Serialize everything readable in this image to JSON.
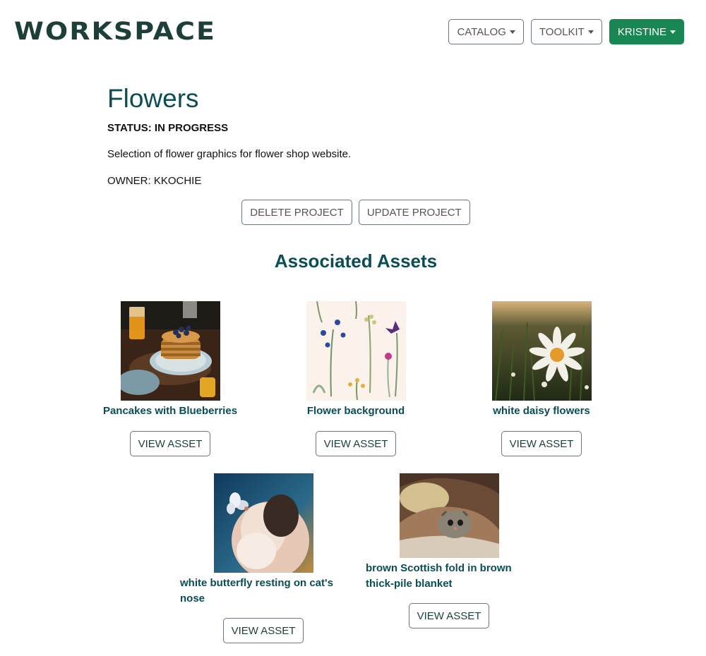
{
  "header": {
    "logo": "WORKSPACE",
    "nav": [
      {
        "label": "CATALOG"
      },
      {
        "label": "TOOLKIT"
      },
      {
        "label": "KRISTINE"
      }
    ]
  },
  "project": {
    "title": "Flowers",
    "status": "STATUS: IN PROGRESS",
    "description": "Selection of flower graphics for flower shop website.",
    "owner": "OWNER: KKOCHIE",
    "delete_label": "DELETE PROJECT",
    "update_label": "UPDATE PROJECT"
  },
  "assets": {
    "heading": "Associated Assets",
    "view_label": "VIEW ASSET",
    "items": [
      {
        "name": "Pancakes with Blueberries"
      },
      {
        "name": "Flower background"
      },
      {
        "name": "white daisy flowers"
      },
      {
        "name": "white butterfly resting on cat's nose"
      },
      {
        "name": "brown Scottish fold in brown thick-pile blanket"
      }
    ]
  },
  "colors": {
    "brand": "#1d3f3a",
    "heading": "#0b4d55",
    "primary": "#198754"
  }
}
